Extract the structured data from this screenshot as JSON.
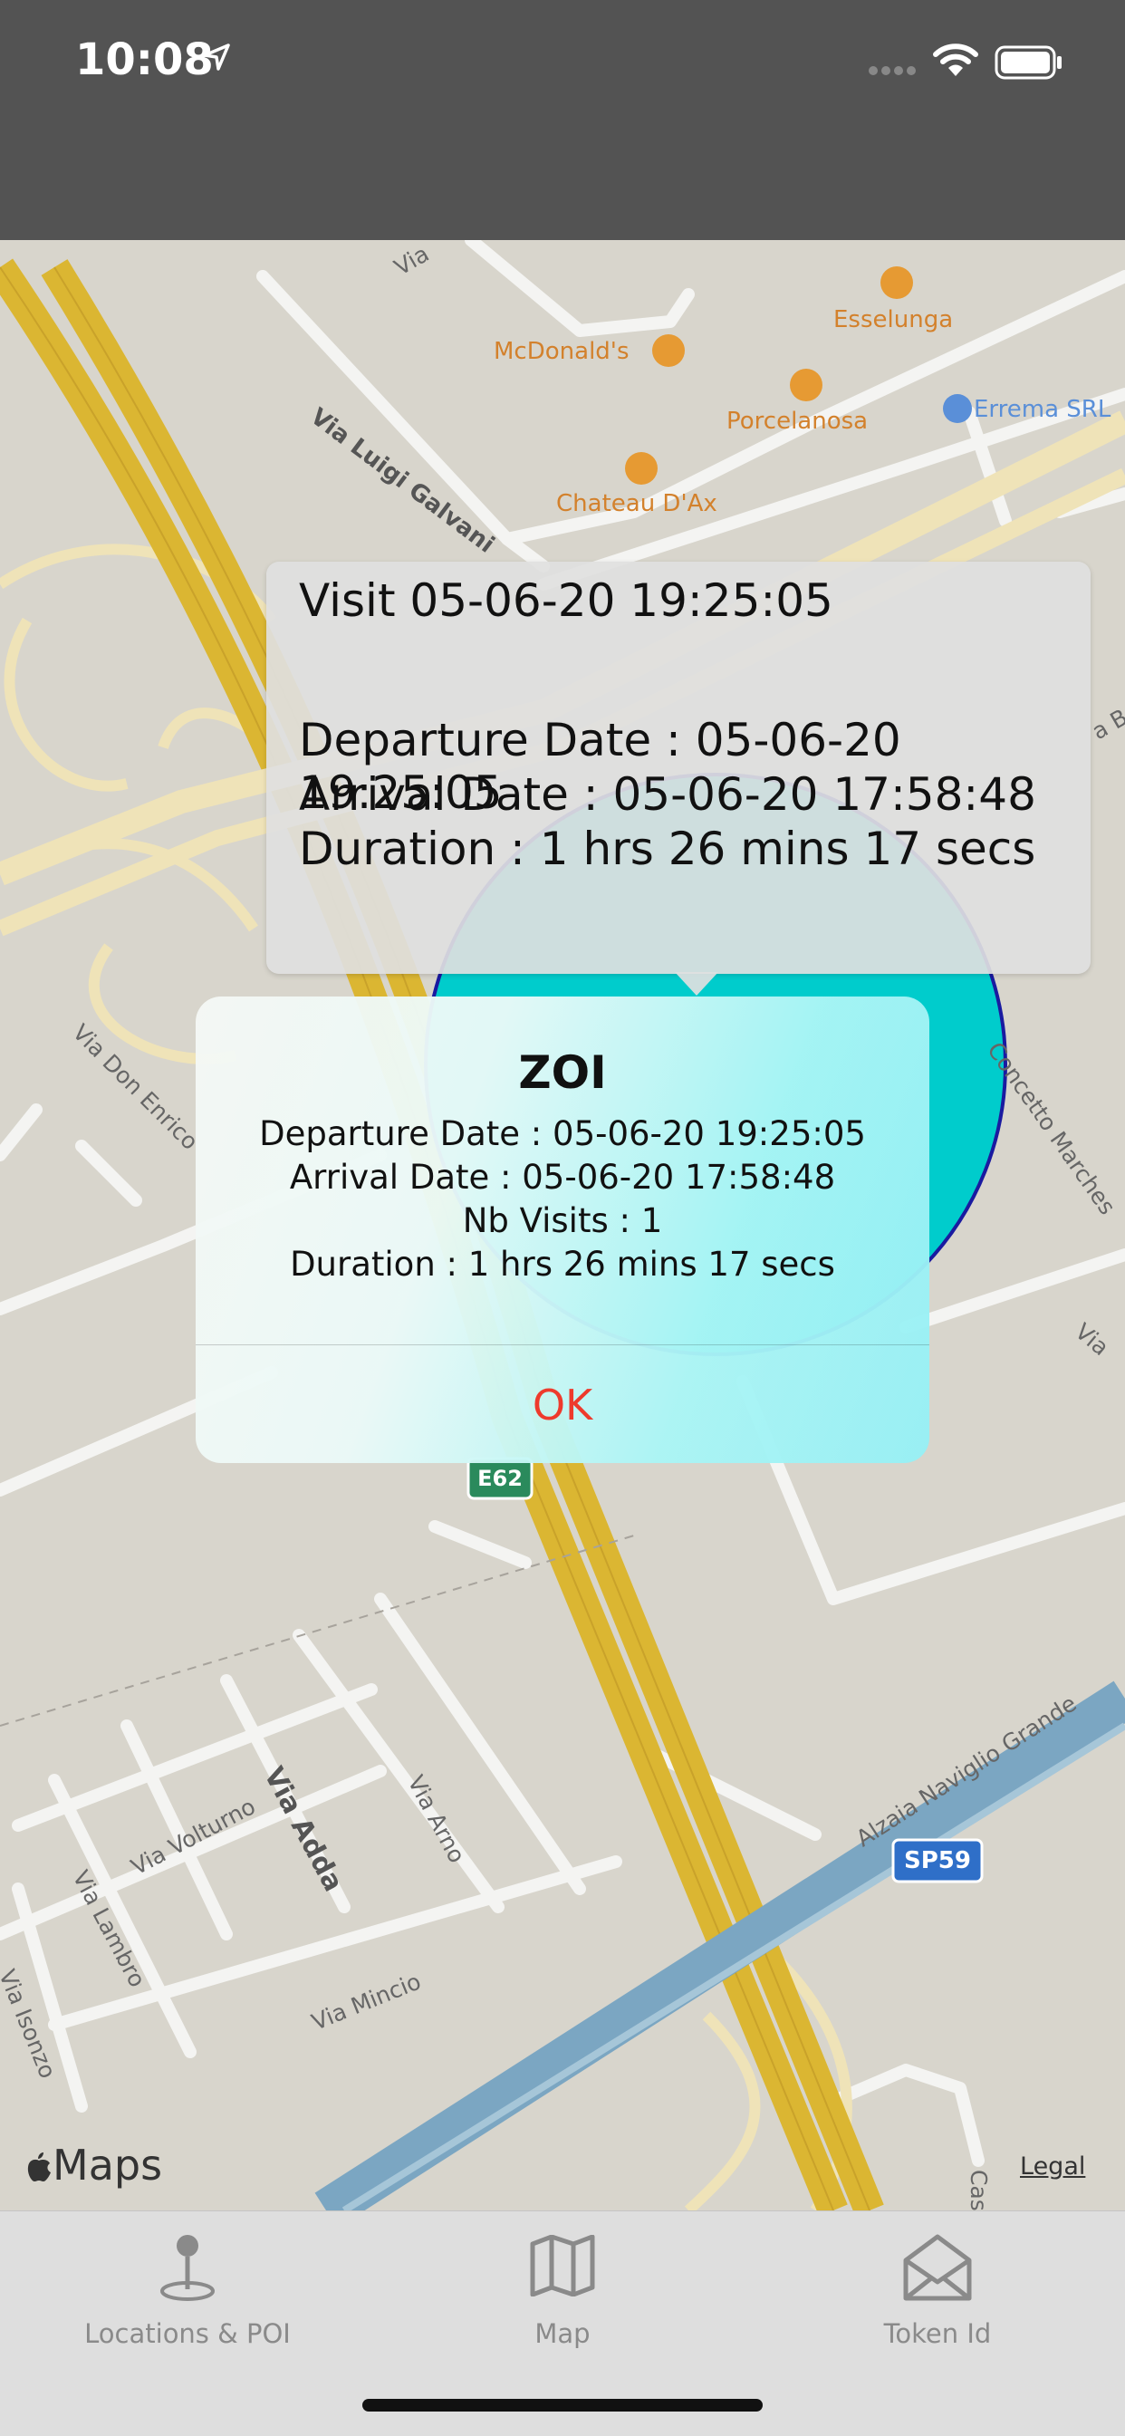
{
  "status_bar": {
    "time": "10:08"
  },
  "map": {
    "pois": {
      "esselunga": "Esselunga",
      "mcdonalds": "McDonald's",
      "porcelanosa": "Porcelanosa",
      "erremo": "Errema SRL",
      "chateau": "Chateau D'Ax"
    },
    "streets": {
      "via_top": "Via",
      "via_luigi_galvani": "Via Luigi Galvani",
      "via_don_enrico": "Via Don Enrico",
      "concetto_marchesi": "Concetto Marches",
      "via_right": "Via",
      "via_b": "a B",
      "via_volturno": "Via Volturno",
      "via_adda": "Via Adda",
      "via_arno": "Via Arno",
      "via_lambro": "Via Lambro",
      "via_isonzo": "Via Isonzo",
      "via_mincio": "Via Mincio",
      "alzaia": "Alzaia Naviglio Grande",
      "cas": "Cas"
    },
    "shields": {
      "e62": "E62",
      "sp59": "SP59"
    },
    "maps_logo": "Maps",
    "legal": "Legal"
  },
  "callout": {
    "title": "Visit 05-06-20 19:25:05",
    "departure": "Departure Date : 05-06-20 19:25:05",
    "arrival": "Arrival Date : 05-06-20 17:58:48",
    "duration": "Duration : 1 hrs 26 mins 17 secs"
  },
  "alert": {
    "title": "ZOI",
    "departure": "Departure Date : 05-06-20 19:25:05",
    "arrival": "Arrival Date : 05-06-20 17:58:48",
    "visits": "Nb Visits : 1",
    "duration": "Duration : 1 hrs 26 mins 17 secs",
    "ok_label": "OK"
  },
  "tabs": [
    {
      "label": "Locations & POI",
      "icon": "pin-icon"
    },
    {
      "label": "Map",
      "icon": "map-icon"
    },
    {
      "label": "Token Id",
      "icon": "envelope-icon"
    }
  ],
  "colors": {
    "status_bar": "#535353",
    "zoi_fill": "#00cccc",
    "zoi_stroke": "#1a1aa0",
    "ok_button": "#ee3a2c",
    "tab_label": "#8a8a8a"
  }
}
